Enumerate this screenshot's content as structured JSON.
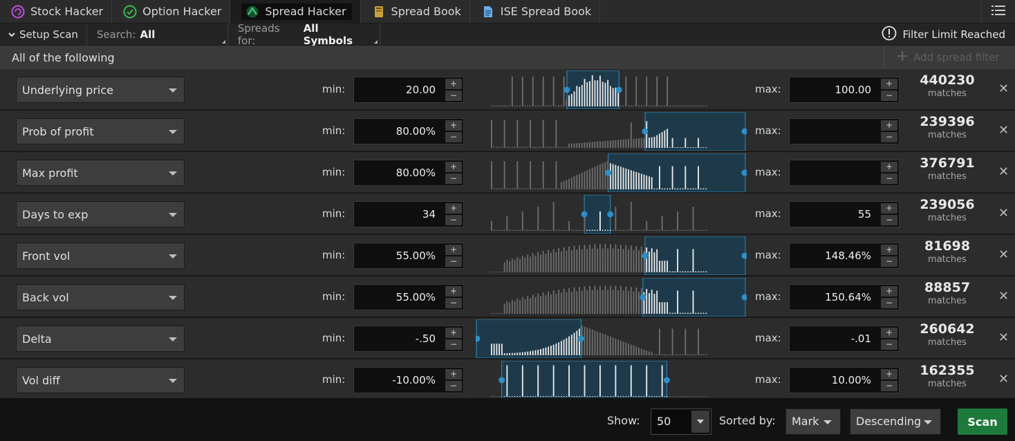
{
  "tabs": [
    {
      "label": "Stock Hacker",
      "icon": "stock-hacker-icon",
      "color": "#b04fd0"
    },
    {
      "label": "Option Hacker",
      "icon": "option-hacker-icon",
      "color": "#35b24a"
    },
    {
      "label": "Spread Hacker",
      "icon": "spread-hacker-icon",
      "color": "#3fc47a",
      "active": true
    },
    {
      "label": "Spread Book",
      "icon": "book-icon",
      "color": "#caa23a"
    },
    {
      "label": "ISE Spread Book",
      "icon": "document-icon",
      "color": "#6aaee8"
    }
  ],
  "setup": {
    "setup_scan": "Setup Scan",
    "search_label": "Search:",
    "search_value": "All",
    "spreads_label": "Spreads for:",
    "spreads_value": "All Symbols",
    "filter_limit": "Filter Limit Reached"
  },
  "group": {
    "label": "All of the following",
    "add_filter": "Add spread filter"
  },
  "labels": {
    "min": "min:",
    "max": "max:",
    "matches": "matches"
  },
  "filters": [
    {
      "name": "Underlying price",
      "min": "20.00",
      "max": "100.00",
      "count": "440230",
      "sel": [
        0.35,
        0.59
      ],
      "shape": "price"
    },
    {
      "name": "Prob of profit",
      "min": "80.00%",
      "max": "",
      "count": "239396",
      "sel": [
        0.71,
        1.0
      ],
      "shape": "pop"
    },
    {
      "name": "Max profit",
      "min": "80.00%",
      "max": "",
      "count": "376791",
      "sel": [
        0.54,
        1.0
      ],
      "shape": "maxp"
    },
    {
      "name": "Days to exp",
      "min": "34",
      "max": "55",
      "count": "239056",
      "sel": [
        0.43,
        0.55
      ],
      "shape": "dte"
    },
    {
      "name": "Front vol",
      "min": "55.00%",
      "max": "148.46%",
      "count": "81698",
      "sel": [
        0.71,
        1.0
      ],
      "shape": "vol"
    },
    {
      "name": "Back vol",
      "min": "55.00%",
      "max": "150.64%",
      "count": "88857",
      "sel": [
        0.7,
        1.0
      ],
      "shape": "vol"
    },
    {
      "name": "Delta",
      "min": "-.50",
      "max": "-.01",
      "count": "260642",
      "sel": [
        0.0,
        0.415
      ],
      "shape": "delta"
    },
    {
      "name": "Vol diff",
      "min": "-10.00%",
      "max": "10.00%",
      "count": "162355",
      "sel": [
        0.05,
        0.81
      ],
      "shape": "vdiff"
    }
  ],
  "bottom": {
    "show_label": "Show:",
    "show_value": "50",
    "sorted_label": "Sorted by:",
    "sort_field": "Mark",
    "sort_order": "Descending",
    "scan": "Scan"
  },
  "colors": {
    "selection_fill": "#1e3a4a",
    "selection_border": "#2c8fc7",
    "handle": "#2c8fc7",
    "bar": "#6e6e6e",
    "bar_selected": "#e9e9e9",
    "scan_button": "#1e7a3c"
  }
}
